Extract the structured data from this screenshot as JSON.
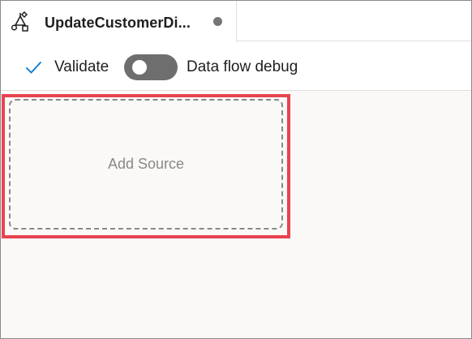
{
  "tab": {
    "title": "UpdateCustomerDi...",
    "icon": "data-flow-icon",
    "unsaved_indicator": true
  },
  "toolbar": {
    "validate_label": "Validate",
    "validate_icon": "checkmark-icon",
    "debug_label": "Data flow debug",
    "debug_enabled": false
  },
  "canvas": {
    "add_source_label": "Add Source",
    "highlight_color": "#e8434f"
  },
  "colors": {
    "accent": "#0078d4",
    "canvas_bg": "#faf9f8",
    "toggle_off": "#6e6e6e"
  }
}
